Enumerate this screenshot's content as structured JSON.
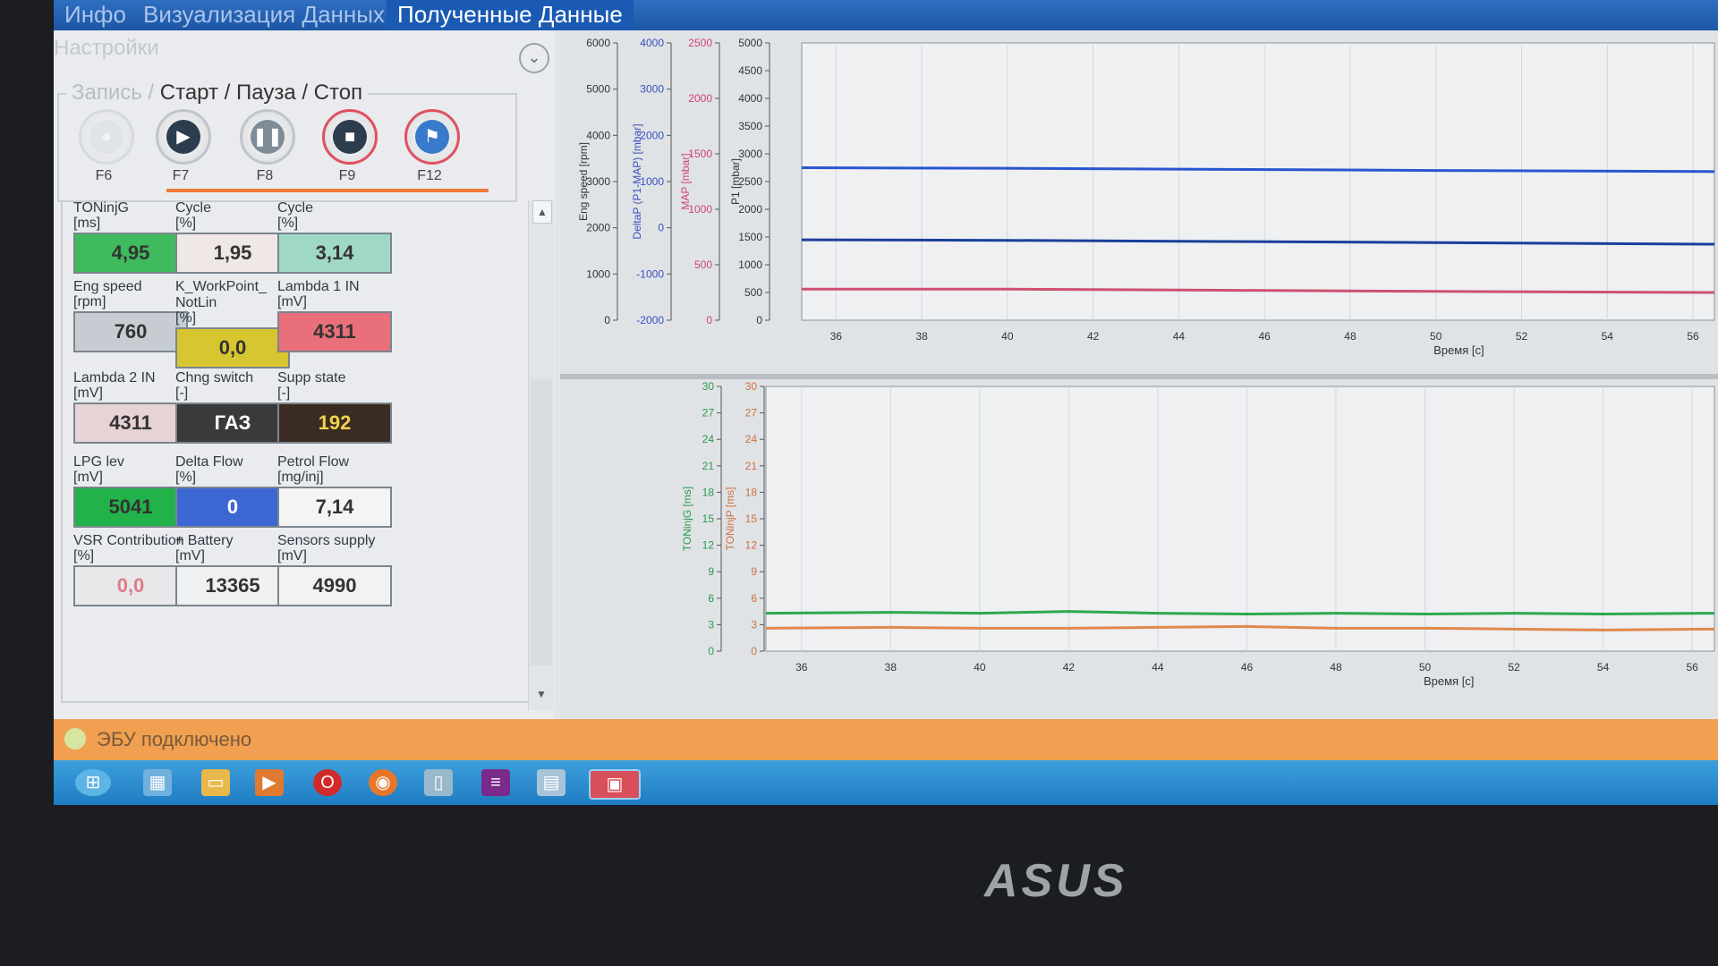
{
  "tabs": [
    "Инфо",
    "Визуализация Данных",
    "Полученные Данные"
  ],
  "settings_label": "Настройки",
  "record_title_faded": "Запись / ",
  "record_title": "Старт / Пауза / Стоп",
  "record_keys": [
    "F6",
    "F7",
    "F8",
    "F9",
    "F12"
  ],
  "gauges": [
    {
      "label": "TONinjG",
      "unit": "[ms]",
      "value": "4,95",
      "color": "#3fbb5e"
    },
    {
      "label": "Cycle",
      "unit": "[%]",
      "value": "1,95",
      "color": "#efe8e6"
    },
    {
      "label": "Cycle",
      "unit": "[%]",
      "value": "3,14",
      "color": "#9fd8c4"
    },
    {
      "label": "Eng speed",
      "unit": "[rpm]",
      "value": "760",
      "color": "#c6ccd2"
    },
    {
      "label": "K_WorkPoint_ NotLin",
      "unit": "[%]",
      "value": "0,0",
      "color": "#d7c630"
    },
    {
      "label": "Lambda 1 IN",
      "unit": "[mV]",
      "value": "4311",
      "color": "#e9707a"
    },
    {
      "label": "Lambda 2 IN",
      "unit": "[mV]",
      "value": "4311",
      "color": "#e6d3d6"
    },
    {
      "label": "Chng switch",
      "unit": "[-]",
      "value": "ГАЗ",
      "color": "#3a3a3a"
    },
    {
      "label": "Supp state",
      "unit": "[-]",
      "value": "192",
      "color": "#3a2c22"
    },
    {
      "label": "LPG lev",
      "unit": "[mV]",
      "value": "5041",
      "color": "#22b24a"
    },
    {
      "label": "Delta Flow",
      "unit": "[%]",
      "value": "0",
      "color": "#3d68d4"
    },
    {
      "label": "Petrol Flow",
      "unit": "[mg/inj]",
      "value": "7,14",
      "color": "#f4f4f4"
    },
    {
      "label": "VSR Contribution",
      "unit": "[%]",
      "value": "0,0",
      "color": "#e8e8ea"
    },
    {
      "label": "+ Battery",
      "unit": "[mV]",
      "value": "13365",
      "color": "#eef0f2"
    },
    {
      "label": "Sensors supply",
      "unit": "[mV]",
      "value": "4990",
      "color": "#f2f2f2"
    }
  ],
  "chart_data": [
    {
      "type": "line",
      "xlabel": "Время [c]",
      "xlim": [
        35.2,
        56.5
      ],
      "x_ticks": [
        36,
        38,
        40,
        42,
        44,
        46,
        48,
        50,
        52,
        54,
        56
      ],
      "axes": [
        {
          "label": "Eng speed [rpm]",
          "ticks": [
            0,
            1000,
            2000,
            3000,
            4000,
            5000,
            6000
          ],
          "color": "#333333"
        },
        {
          "label": "DeltaP (P1-MAP) [mbar]",
          "ticks": [
            -2000,
            -1000,
            0,
            1000,
            2000,
            3000,
            4000
          ],
          "color": "#3a4fc0"
        },
        {
          "label": "MAP [mbar]",
          "ticks": [
            0,
            500,
            1000,
            1500,
            2000,
            2500
          ],
          "color": "#d0407a"
        },
        {
          "label": "P1 [mbar]",
          "ticks": [
            0,
            500,
            1000,
            1500,
            2000,
            2500,
            3000,
            3500,
            4000,
            4500,
            5000
          ],
          "color": "#333333"
        }
      ],
      "series": [
        {
          "x": [
            35.2,
            40,
            45,
            50,
            56.5
          ],
          "values": [
            2750,
            2740,
            2720,
            2700,
            2680
          ],
          "color": "#2a55d0"
        },
        {
          "x": [
            35.2,
            40,
            45,
            50,
            56.5
          ],
          "values": [
            1450,
            1440,
            1420,
            1400,
            1370
          ],
          "color": "#1a3f9a"
        },
        {
          "x": [
            35.2,
            40,
            45,
            50,
            56.5
          ],
          "values": [
            560,
            560,
            540,
            520,
            500
          ],
          "color": "#d05070"
        }
      ]
    },
    {
      "type": "line",
      "xlabel": "Время [c]",
      "xlim": [
        35.2,
        56.5
      ],
      "x_ticks": [
        36,
        38,
        40,
        42,
        44,
        46,
        48,
        50,
        52,
        54,
        56
      ],
      "axes": [
        {
          "label": "TONinjG [ms]",
          "ticks": [
            0,
            3,
            6,
            9,
            12,
            15,
            18,
            21,
            24,
            27,
            30
          ],
          "color": "#2a9a4a"
        },
        {
          "label": "TONinjP [ms]",
          "ticks": [
            0,
            3,
            6,
            9,
            12,
            15,
            18,
            21,
            24,
            27,
            30
          ],
          "color": "#d07040"
        }
      ],
      "series": [
        {
          "x": [
            35.2,
            38,
            40,
            42,
            44,
            46,
            48,
            50,
            52,
            54,
            56.5
          ],
          "values": [
            4.3,
            4.4,
            4.3,
            4.5,
            4.3,
            4.2,
            4.3,
            4.2,
            4.3,
            4.2,
            4.3
          ],
          "color": "#2fa84a"
        },
        {
          "x": [
            35.2,
            38,
            40,
            42,
            44,
            46,
            48,
            50,
            52,
            54,
            56.5
          ],
          "values": [
            2.6,
            2.7,
            2.6,
            2.6,
            2.7,
            2.8,
            2.6,
            2.6,
            2.5,
            2.4,
            2.5
          ],
          "color": "#e08a4a"
        }
      ]
    }
  ],
  "status_text": "ЭБУ подключено",
  "bezel_brand": "ASUS"
}
